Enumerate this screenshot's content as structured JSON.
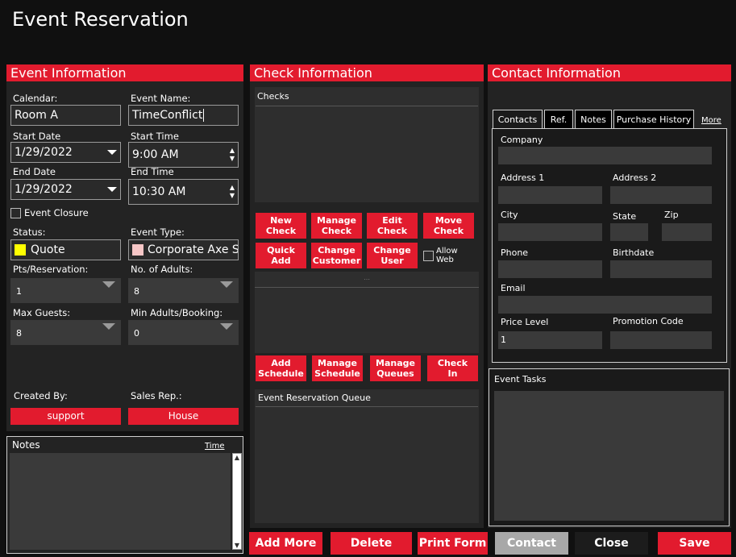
{
  "window": {
    "title": "Event Reservation"
  },
  "event_info": {
    "header": "Event Information",
    "calendar_label": "Calendar:",
    "calendar_value": "Room A",
    "event_name_label": "Event Name:",
    "event_name_value": "TimeConflict",
    "start_date_label": "Start Date",
    "start_date_value": "1/29/2022",
    "start_time_label": "Start Time",
    "start_time_value": "9:00 AM",
    "end_date_label": "End Date",
    "end_date_value": "1/29/2022",
    "end_time_label": "End Time",
    "end_time_value": "10:30 AM",
    "event_closure_label": "Event Closure",
    "status_label": "Status:",
    "status_value": "Quote",
    "status_color": "#ffff00",
    "event_type_label": "Event Type:",
    "event_type_value": "Corporate Axe S...",
    "event_type_color": "#f6c6c6",
    "pts_label": "Pts/Reservation:",
    "pts_value": "1",
    "adults_label": "No. of Adults:",
    "adults_value": "8",
    "max_guests_label": "Max Guests:",
    "max_guests_value": "8",
    "min_adults_label": "Min Adults/Booking:",
    "min_adults_value": "0",
    "created_by_label": "Created By:",
    "created_by_value": "support",
    "sales_rep_label": "Sales Rep.:",
    "sales_rep_value": "House"
  },
  "notes": {
    "label": "Notes",
    "time_link": "Time"
  },
  "check_info": {
    "header": "Check Information",
    "checks_label": "Checks",
    "buttons_row1": [
      "New\nCheck",
      "Manage\nCheck",
      "Edit\nCheck",
      "Move\nCheck"
    ],
    "buttons_row2": [
      "Quick\nAdd",
      "Change\nCustomer",
      "Change\nUser"
    ],
    "allow_web_label": "Allow\nWeb",
    "buttons_row3": [
      "Add\nSchedule",
      "Manage\nSchedule",
      "Manage\nQueues",
      "Check\nIn"
    ],
    "queue_label": "Event Reservation Queue"
  },
  "contact_info": {
    "header": "Contact Information",
    "tabs": [
      "Contacts",
      "Ref.",
      "Notes",
      "Purchase History"
    ],
    "more_link": "More",
    "company_label": "Company",
    "address1_label": "Address 1",
    "address2_label": "Address 2",
    "city_label": "City",
    "state_label": "State",
    "zip_label": "Zip",
    "phone_label": "Phone",
    "birthdate_label": "Birthdate",
    "email_label": "Email",
    "price_level_label": "Price Level",
    "price_level_value": "1",
    "promo_label": "Promotion Code",
    "event_tasks_label": "Event Tasks"
  },
  "footer": {
    "add_more": "Add More",
    "delete": "Delete",
    "print_form": "Print Form",
    "contact": "Contact",
    "close": "Close",
    "save": "Save"
  }
}
